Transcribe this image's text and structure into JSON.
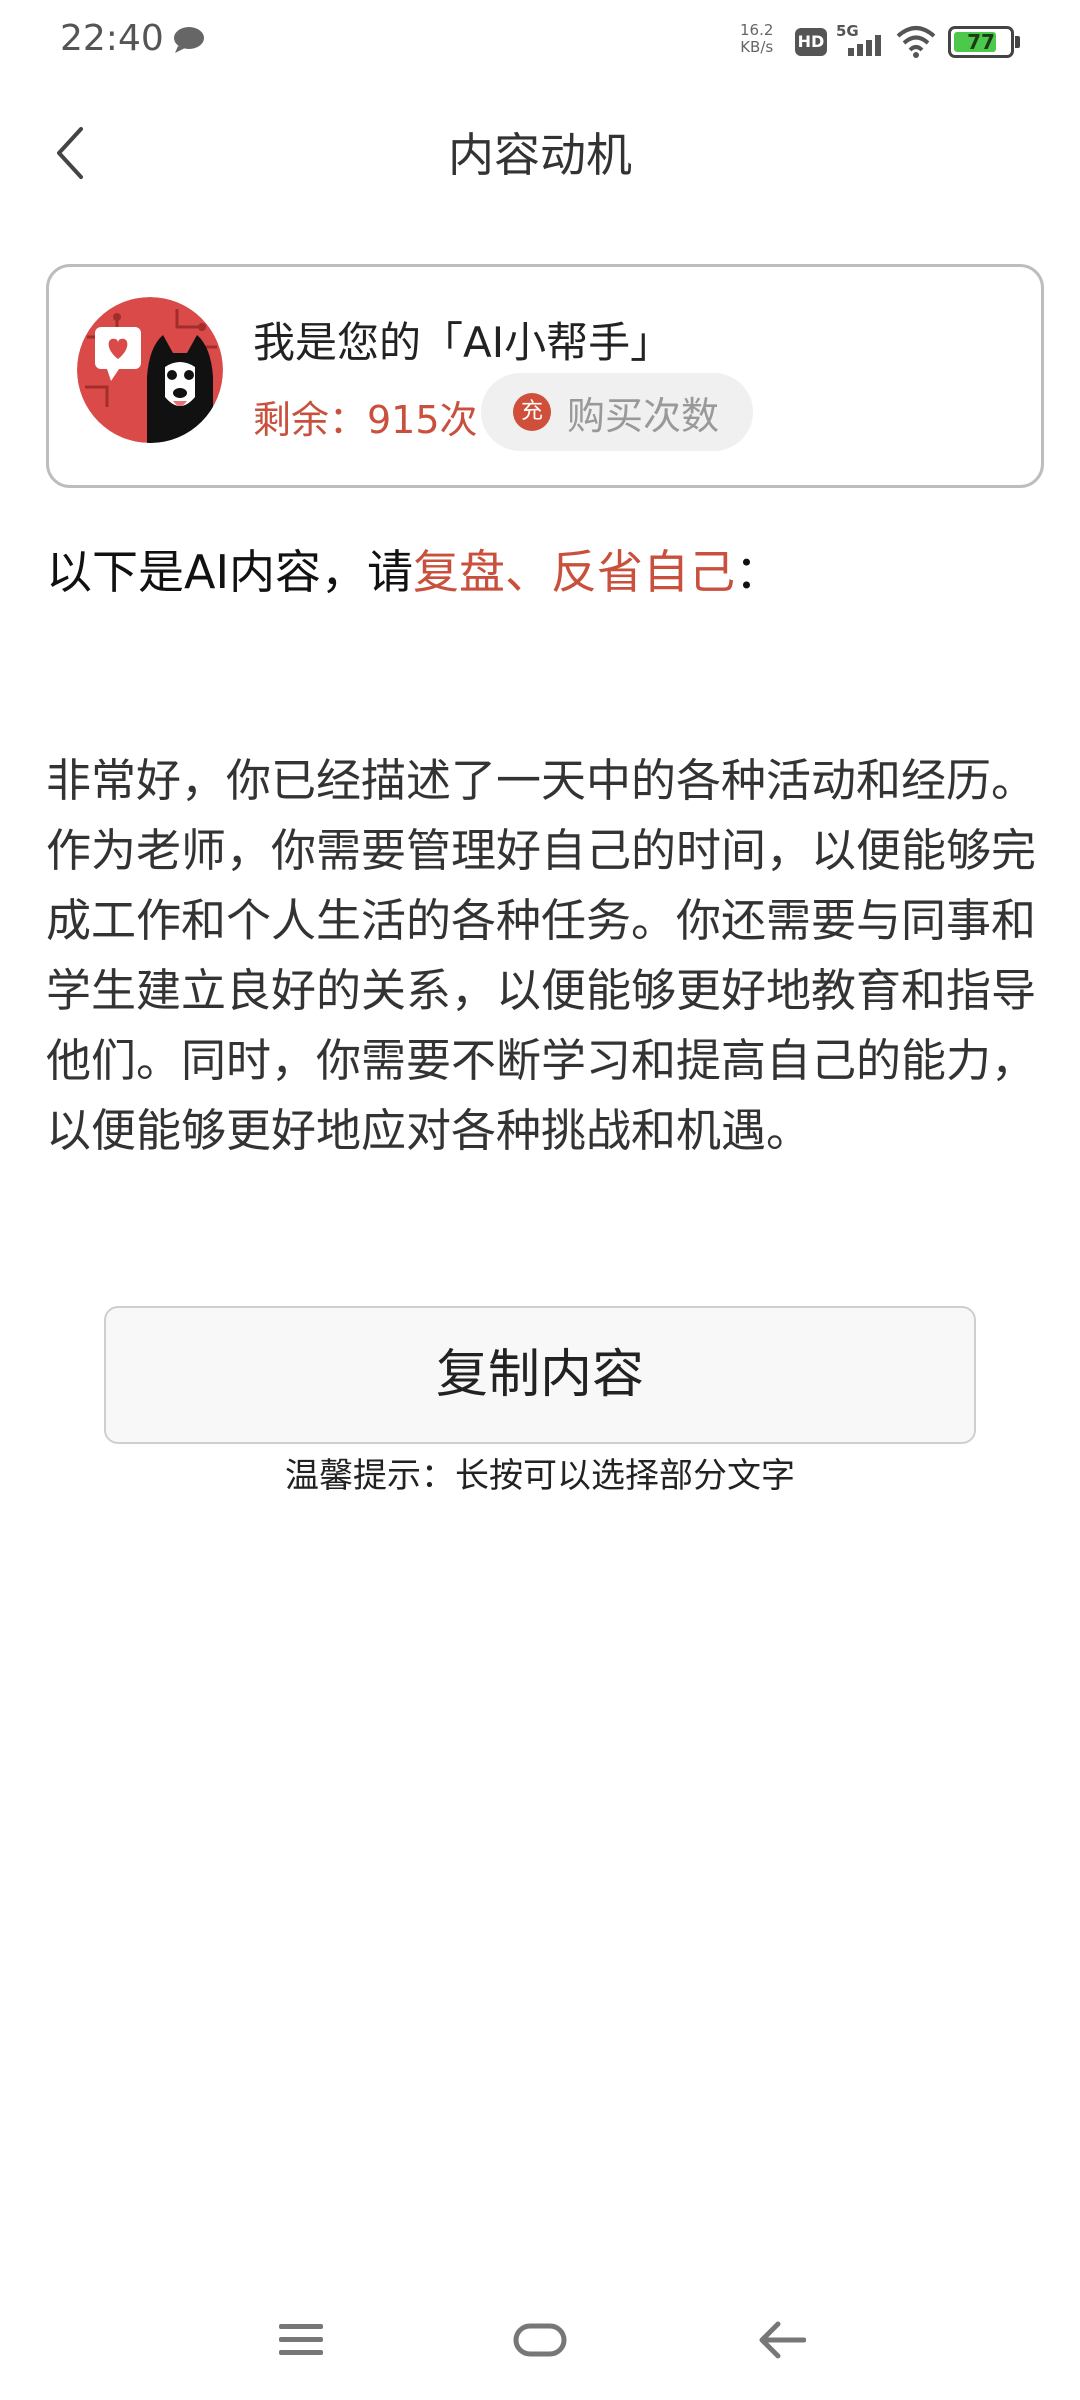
{
  "status_bar": {
    "time": "22:40",
    "net_speed_value": "16.2",
    "net_speed_unit": "KB/s",
    "hd_label": "HD",
    "network": "5G",
    "battery_level": "77",
    "battery_fraction": 0.77
  },
  "header": {
    "title": "内容动机"
  },
  "assistant": {
    "name": "我是您的「AI小帮手」",
    "remaining": "剩余：915次",
    "charge_icon_label": "充",
    "buy_label": "购买次数"
  },
  "intro": {
    "prefix": "以下是AI内容，请",
    "highlight": "复盘、反省自己",
    "suffix": "："
  },
  "content": {
    "text": "非常好，你已经描述了一天中的各种活动和经历。作为老师，你需要管理好自己的时间，以便能够完成工作和个人生活的各种任务。你还需要与同事和学生建立良好的关系，以便能够更好地教育和指导他们。同时，你需要不断学习和提高自己的能力，以便能够更好地应对各种挑战和机遇。"
  },
  "actions": {
    "copy_label": "复制内容",
    "tip": "温馨提示：长按可以选择部分文字"
  },
  "colors": {
    "accent": "#c8503c",
    "charge_icon": "#cf4f3a",
    "battery_fill": "#4cc94a"
  },
  "icons": {
    "back": "chevron-left-icon",
    "chat": "chat-bubble-icon",
    "menu": "menu-icon",
    "home": "home-icon",
    "nav_back": "arrow-left-icon"
  }
}
